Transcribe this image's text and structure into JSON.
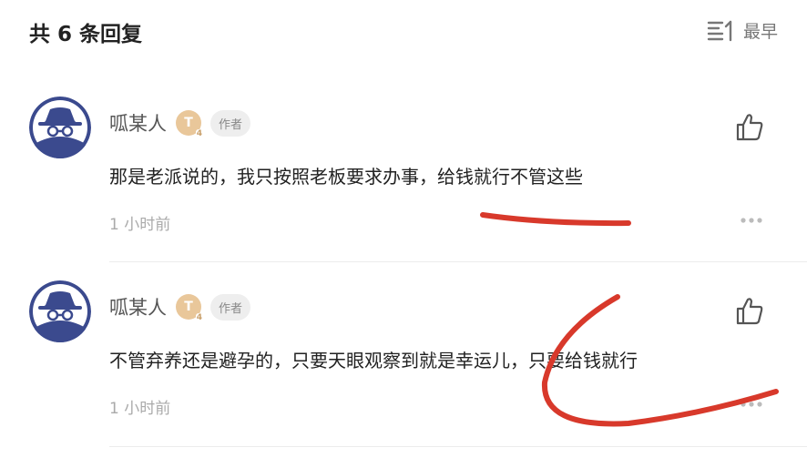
{
  "header": {
    "title": "共 6 条回复",
    "sort_label": "最早"
  },
  "comments": [
    {
      "username": "呱某人",
      "level": "T",
      "level_sub": "4",
      "author_tag": "作者",
      "content": "那是老派说的，我只按照老板要求办事，给钱就行不管这些",
      "time": "1 小时前"
    },
    {
      "username": "呱某人",
      "level": "T",
      "level_sub": "4",
      "author_tag": "作者",
      "content": "不管弃养还是避孕的，只要天眼观察到就是幸运儿，只要给钱就行",
      "time": "1 小时前"
    }
  ],
  "colors": {
    "annotation_red": "#d8392b",
    "avatar_blue": "#3b4a8e"
  }
}
